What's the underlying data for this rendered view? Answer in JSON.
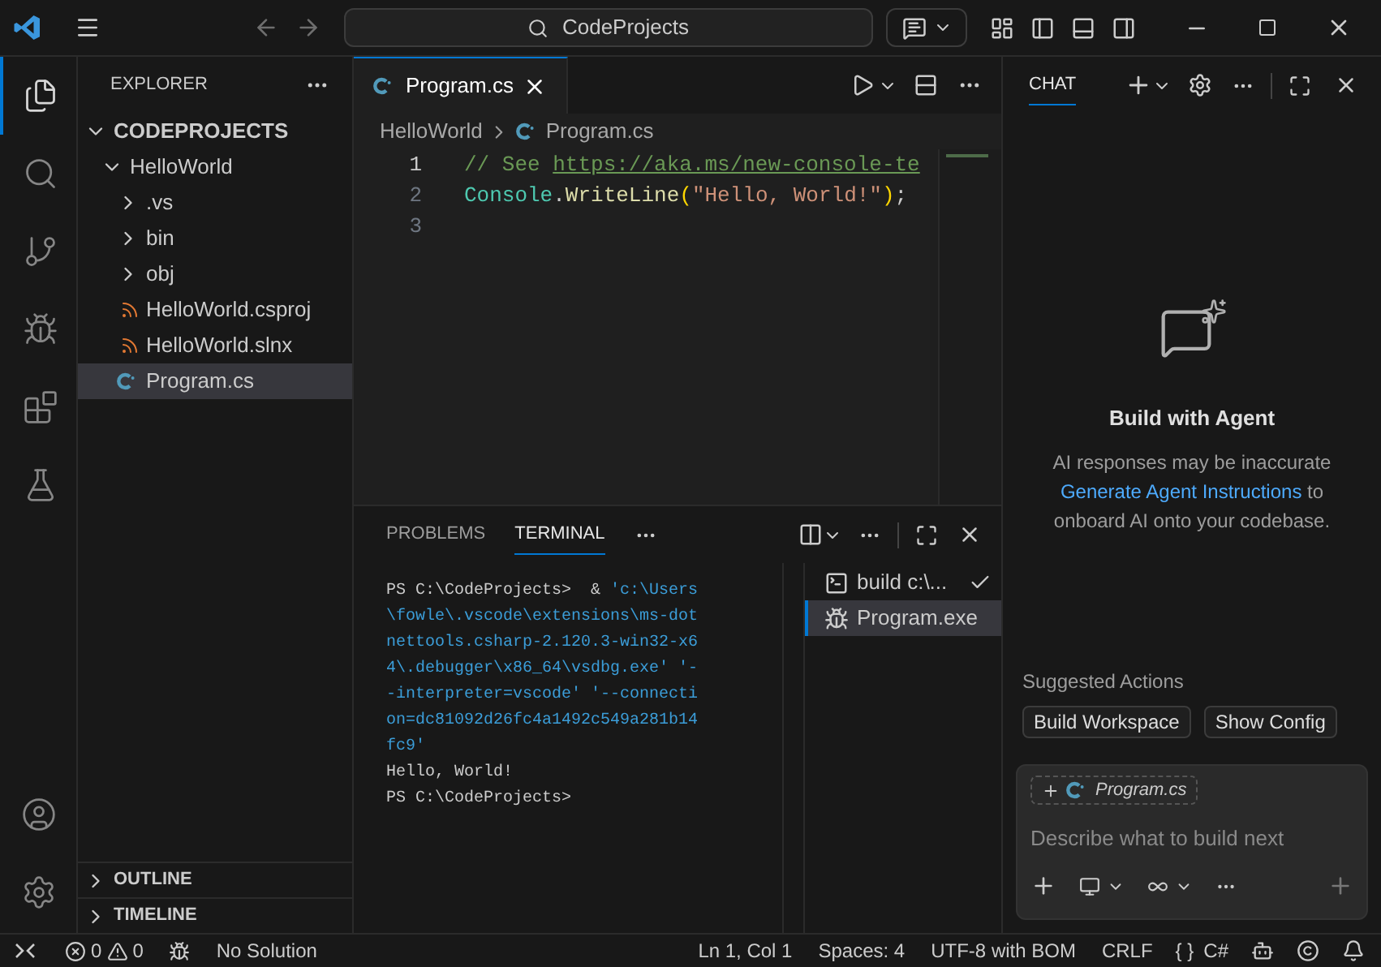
{
  "title_bar": {
    "search": "CodeProjects"
  },
  "activity_bar": {
    "items": [
      {
        "kind": "explorer",
        "selected": true
      },
      {
        "kind": "search",
        "selected": false
      },
      {
        "kind": "source-control",
        "selected": false
      },
      {
        "kind": "run",
        "selected": false
      },
      {
        "kind": "extensions",
        "selected": false
      },
      {
        "kind": "testing",
        "selected": false
      }
    ]
  },
  "sidebar": {
    "title": "EXPLORER",
    "tree": [
      {
        "label": "CODEPROJECTS",
        "kind": "root",
        "expanded": true,
        "selected": false,
        "children": [
          {
            "label": "HelloWorld",
            "kind": "folder",
            "expanded": true,
            "selected": false,
            "children": [
              {
                "label": ".vs",
                "kind": "folder",
                "expanded": false,
                "selected": false
              },
              {
                "label": "bin",
                "kind": "folder",
                "expanded": false,
                "selected": false
              },
              {
                "label": "obj",
                "kind": "folder",
                "expanded": false,
                "selected": false
              },
              {
                "label": "HelloWorld.csproj",
                "kind": "project",
                "selected": false
              },
              {
                "label": "HelloWorld.slnx",
                "kind": "project",
                "selected": false
              },
              {
                "label": "Program.cs",
                "kind": "csharp",
                "selected": true
              }
            ]
          }
        ]
      }
    ],
    "sections": [
      {
        "label": "OUTLINE",
        "expanded": false
      },
      {
        "label": "TIMELINE",
        "expanded": false
      }
    ]
  },
  "editor": {
    "tabs": [
      {
        "label": "Program.cs",
        "selected": true
      }
    ],
    "breadcrumb": [
      "HelloWorld",
      "Program.cs"
    ],
    "lines": [
      {
        "number": "1",
        "current": true,
        "tokens": [
          {
            "kind": "comment",
            "text": "// See "
          },
          {
            "kind": "link",
            "text": "https://aka.ms/new-console-te"
          }
        ]
      },
      {
        "number": "2",
        "current": false,
        "tokens": [
          {
            "kind": "type",
            "text": "Console"
          },
          {
            "kind": "plain",
            "text": "."
          },
          {
            "kind": "method",
            "text": "WriteLine"
          },
          {
            "kind": "paren",
            "text": "("
          },
          {
            "kind": "string",
            "text": "\"Hello, World!\""
          },
          {
            "kind": "paren",
            "text": ")"
          },
          {
            "kind": "plain",
            "text": ";"
          }
        ]
      },
      {
        "number": "3",
        "current": false
      }
    ]
  },
  "panel": {
    "tabs": [
      {
        "label": "PROBLEMS",
        "selected": false
      },
      {
        "label": "TERMINAL",
        "selected": true
      }
    ],
    "terminal": [
      [
        {
          "kind": "plain",
          "text": "PS C:\\CodeProjects>  & "
        },
        {
          "kind": "command",
          "text": "'c:\\Users"
        }
      ],
      [
        {
          "kind": "command",
          "text": "\\fowle\\.vscode\\extensions\\ms-dot"
        }
      ],
      [
        {
          "kind": "command",
          "text": "nettools.csharp-2.120.3-win32-x6"
        }
      ],
      [
        {
          "kind": "command",
          "text": "4\\.debugger\\x86_64\\vsdbg.exe' '-"
        }
      ],
      [
        {
          "kind": "command",
          "text": "-interpreter=vscode' '--connecti"
        }
      ],
      [
        {
          "kind": "command",
          "text": "on=dc81092d26fc4a1492c549a281b14"
        }
      ],
      [
        {
          "kind": "command",
          "text": "fc9'"
        }
      ],
      [
        {
          "kind": "plain",
          "text": "Hello, World!"
        }
      ],
      [
        {
          "kind": "plain",
          "text": "PS C:\\CodeProjects>"
        }
      ]
    ],
    "instances": [
      {
        "label": "build c:\\...",
        "kind": "shell",
        "done": true,
        "selected": false
      },
      {
        "label": "Program.exe",
        "kind": "debug",
        "done": false,
        "selected": true
      }
    ]
  },
  "chat": {
    "tab": "CHAT",
    "heading": "Build with Agent",
    "note": "AI responses may be inaccurate",
    "link": "Generate Agent Instructions",
    "note_end": "to onboard AI onto your codebase.",
    "suggested_title": "Suggested Actions",
    "suggestions": [
      "Build Workspace",
      "Show Config"
    ],
    "attachment": "Program.cs",
    "placeholder": "Describe what to build next"
  },
  "status_bar": {
    "errors": "0",
    "warnings": "0",
    "solution": "No Solution",
    "position": "Ln 1, Col 1",
    "spaces": "Spaces: 4",
    "encoding": "UTF-8 with BOM",
    "eol": "CRLF",
    "braces": "{ }",
    "language": "C#"
  }
}
